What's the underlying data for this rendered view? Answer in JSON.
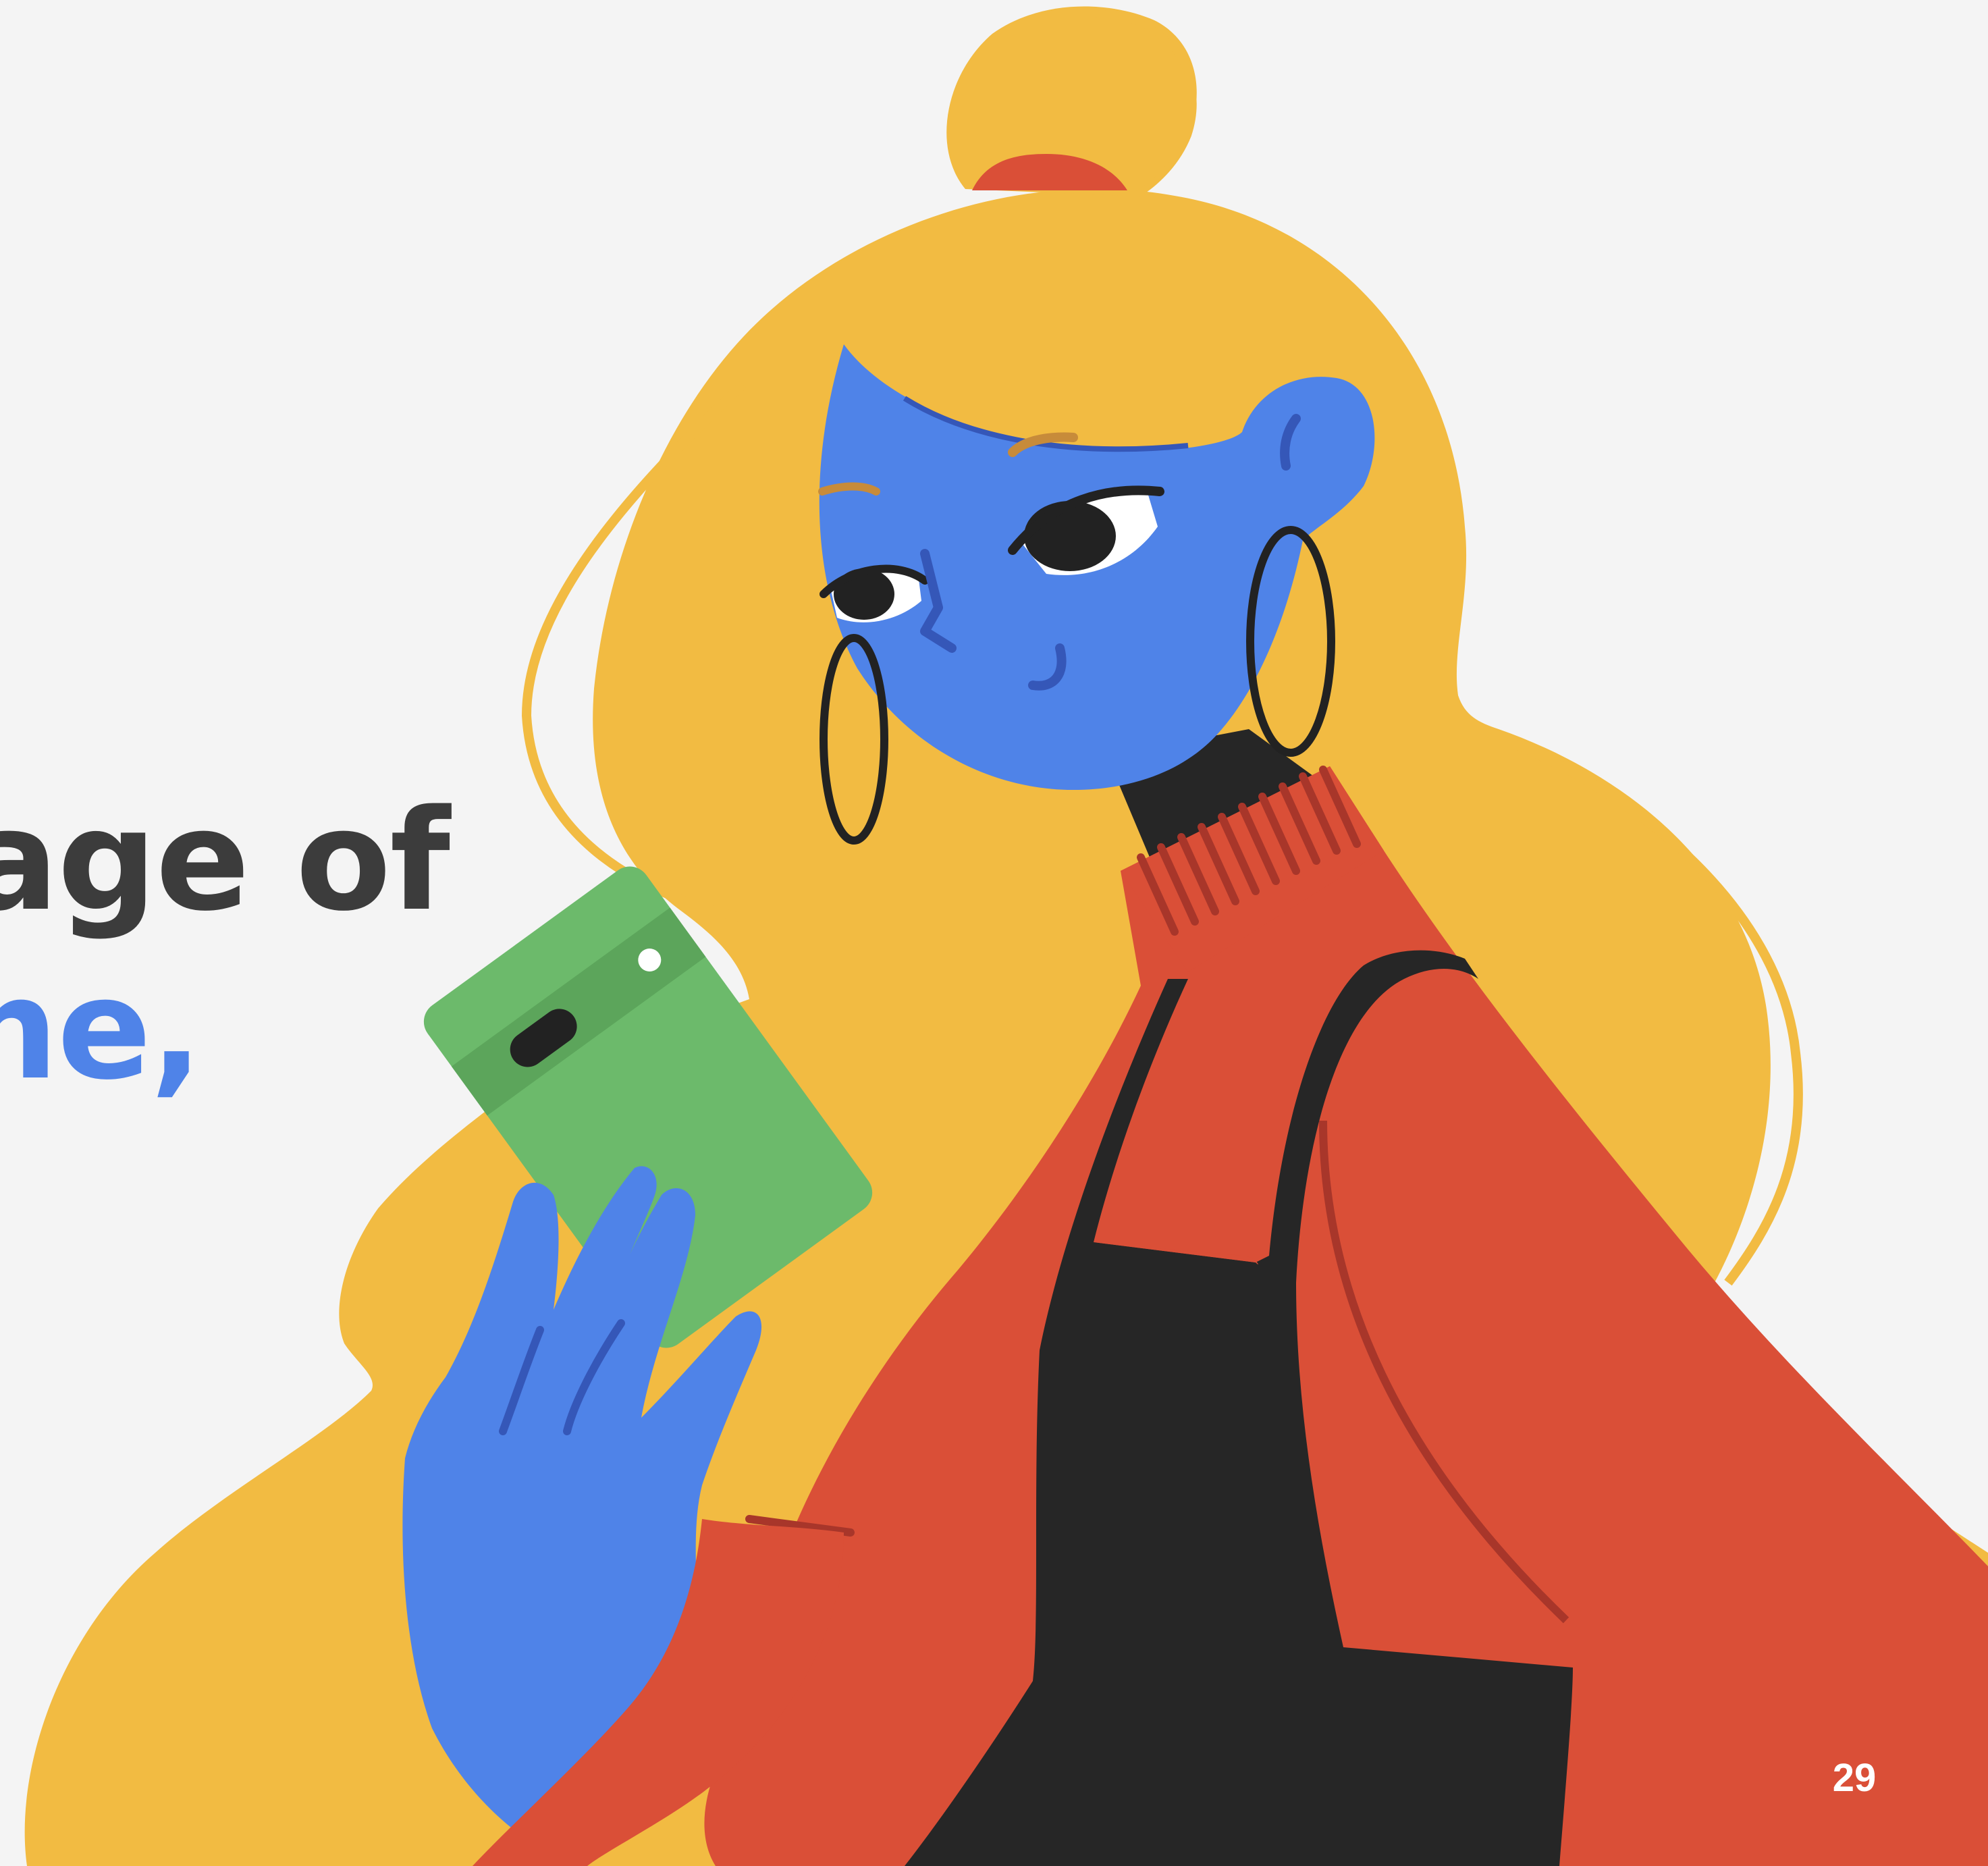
{
  "slide": {
    "heading_line1": "age of",
    "heading_line2": "ne,",
    "page_number": "29"
  },
  "colors": {
    "background": "#f4f4f4",
    "heading_text": "#3c3c3c",
    "heading_accent": "#4f83e8",
    "hair": "#f2bb42",
    "skin": "#4f83e8",
    "jacket": "#da4f37",
    "overalls": "#262626",
    "phone": "#6cba6b"
  },
  "illustration": {
    "subject": "woman-holding-phone",
    "icon": "person-with-phone-illustration"
  }
}
